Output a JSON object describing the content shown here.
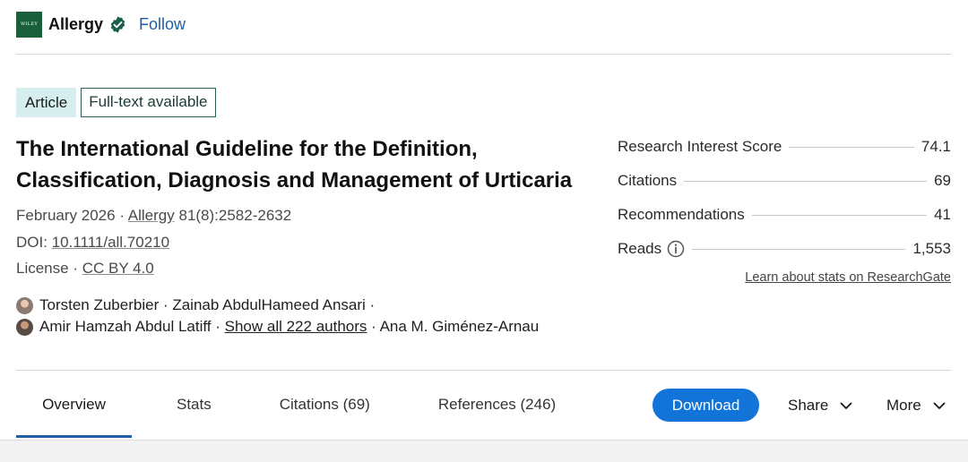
{
  "journal": {
    "logo_text": "WILEY",
    "name": "Allergy",
    "follow_label": "Follow",
    "brand_color": "#1b5e3b",
    "verified_icon": "verified-check-icon"
  },
  "badges": {
    "type": "Article",
    "availability": "Full-text available"
  },
  "article": {
    "title": "The International Guideline for the Definition, Classification, Diagnosis and Management of Urticaria",
    "date": "February 2026",
    "journal_link": "Allergy",
    "volume_pages": "81(8):2582-2632",
    "doi_label": "DOI:",
    "doi": "10.1111/all.70210",
    "license_label": "License ·",
    "license": "CC BY 4.0",
    "separator": "·"
  },
  "authors": {
    "line1": "Torsten Zuberbier · Zainab AbdulHameed Ansari ·",
    "line2_start": "Amir Hamzah Abdul Latiff ·",
    "show_all": "Show all 222 authors",
    "line2_end": "· Ana M. Giménez-Arnau"
  },
  "stats": {
    "rows": [
      {
        "label": "Research Interest Score",
        "value": "74.1"
      },
      {
        "label": "Citations",
        "value": "69"
      },
      {
        "label": "Recommendations",
        "value": "41"
      },
      {
        "label": "Reads",
        "value": "1,553"
      }
    ],
    "learn_link": "Learn about stats on ResearchGate"
  },
  "tabs": {
    "overview": "Overview",
    "stats": "Stats",
    "citations": "Citations (69)",
    "references": "References (246)"
  },
  "actions": {
    "download": "Download",
    "share": "Share",
    "more": "More",
    "accent_color": "#1273d9"
  }
}
